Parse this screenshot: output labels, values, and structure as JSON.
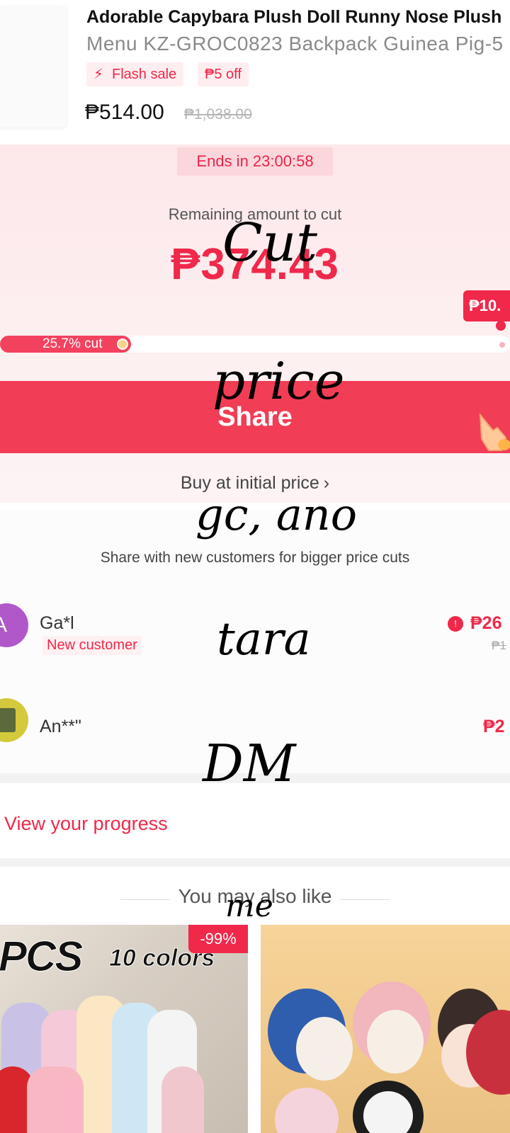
{
  "product": {
    "title": "Adorable Capybara Plush Doll Runny Nose Plush",
    "subtitle": "Menu KZ-GROC0823 Backpack Guinea Pig-5",
    "tags": [
      "Flash sale",
      "₱5 off"
    ],
    "price": "₱514.00",
    "original_price": "₱1,038.00"
  },
  "bargain": {
    "timer": "Ends in 23:00:58",
    "remaining_label": "Remaining amount to cut",
    "remaining_amount": "₱374.43",
    "bubble_amount": "₱10.",
    "progress_label": "25.7% cut",
    "progress_fraction": 0.257,
    "share_button": "Share",
    "buy_initial": "Buy at initial price",
    "share_hint": "Share with new customers for bigger price cuts"
  },
  "helpers": [
    {
      "name": "Ga*l",
      "badge": "New customer",
      "amount": "₱26",
      "old_amount": "₱1",
      "avatar_letter": "A"
    },
    {
      "name": "An**\"",
      "amount": "₱2"
    }
  ],
  "links": {
    "view_progress": "View your progress"
  },
  "recommend": {
    "heading": "You may also like",
    "cards": [
      {
        "headline": "PCS",
        "subhead": "10 colors",
        "discount": "-99%"
      },
      {}
    ]
  },
  "handwriting": [
    "Cut",
    "price",
    "gc, ano",
    "tara",
    "DM",
    "me"
  ],
  "colors": {
    "accent": "#f0284a",
    "panel": "#fde7ea",
    "button": "#f23d56"
  }
}
